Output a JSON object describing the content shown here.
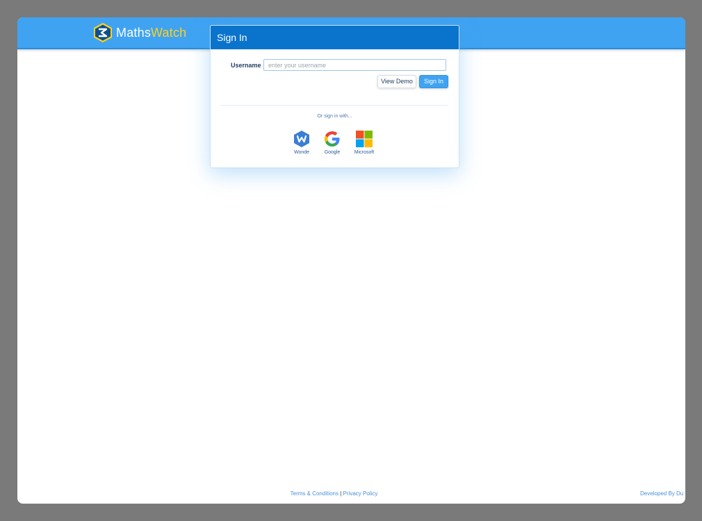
{
  "brand": {
    "name_part1": "Maths",
    "name_part2": "Watch",
    "icon": "mathswatch-logo-icon",
    "colors": {
      "bar": "#3fa3f2",
      "accent": "#ffd11a",
      "header": "#0a74cc"
    }
  },
  "signin": {
    "title": "Sign In",
    "username_label": "Username",
    "username_placeholder": "enter your username",
    "username_value": "",
    "view_demo_label": "View Demo",
    "sign_in_label": "Sign In",
    "or_text": "Or sign in with...",
    "providers": [
      {
        "label": "Wonde",
        "icon": "wonde-icon"
      },
      {
        "label": "Google",
        "icon": "google-icon"
      },
      {
        "label": "Microsoft",
        "icon": "microsoft-icon"
      }
    ]
  },
  "footer": {
    "terms": "Terms & Conditions",
    "separator": "|",
    "privacy": "Privacy Policy",
    "developed_by": "Developed By Du"
  }
}
